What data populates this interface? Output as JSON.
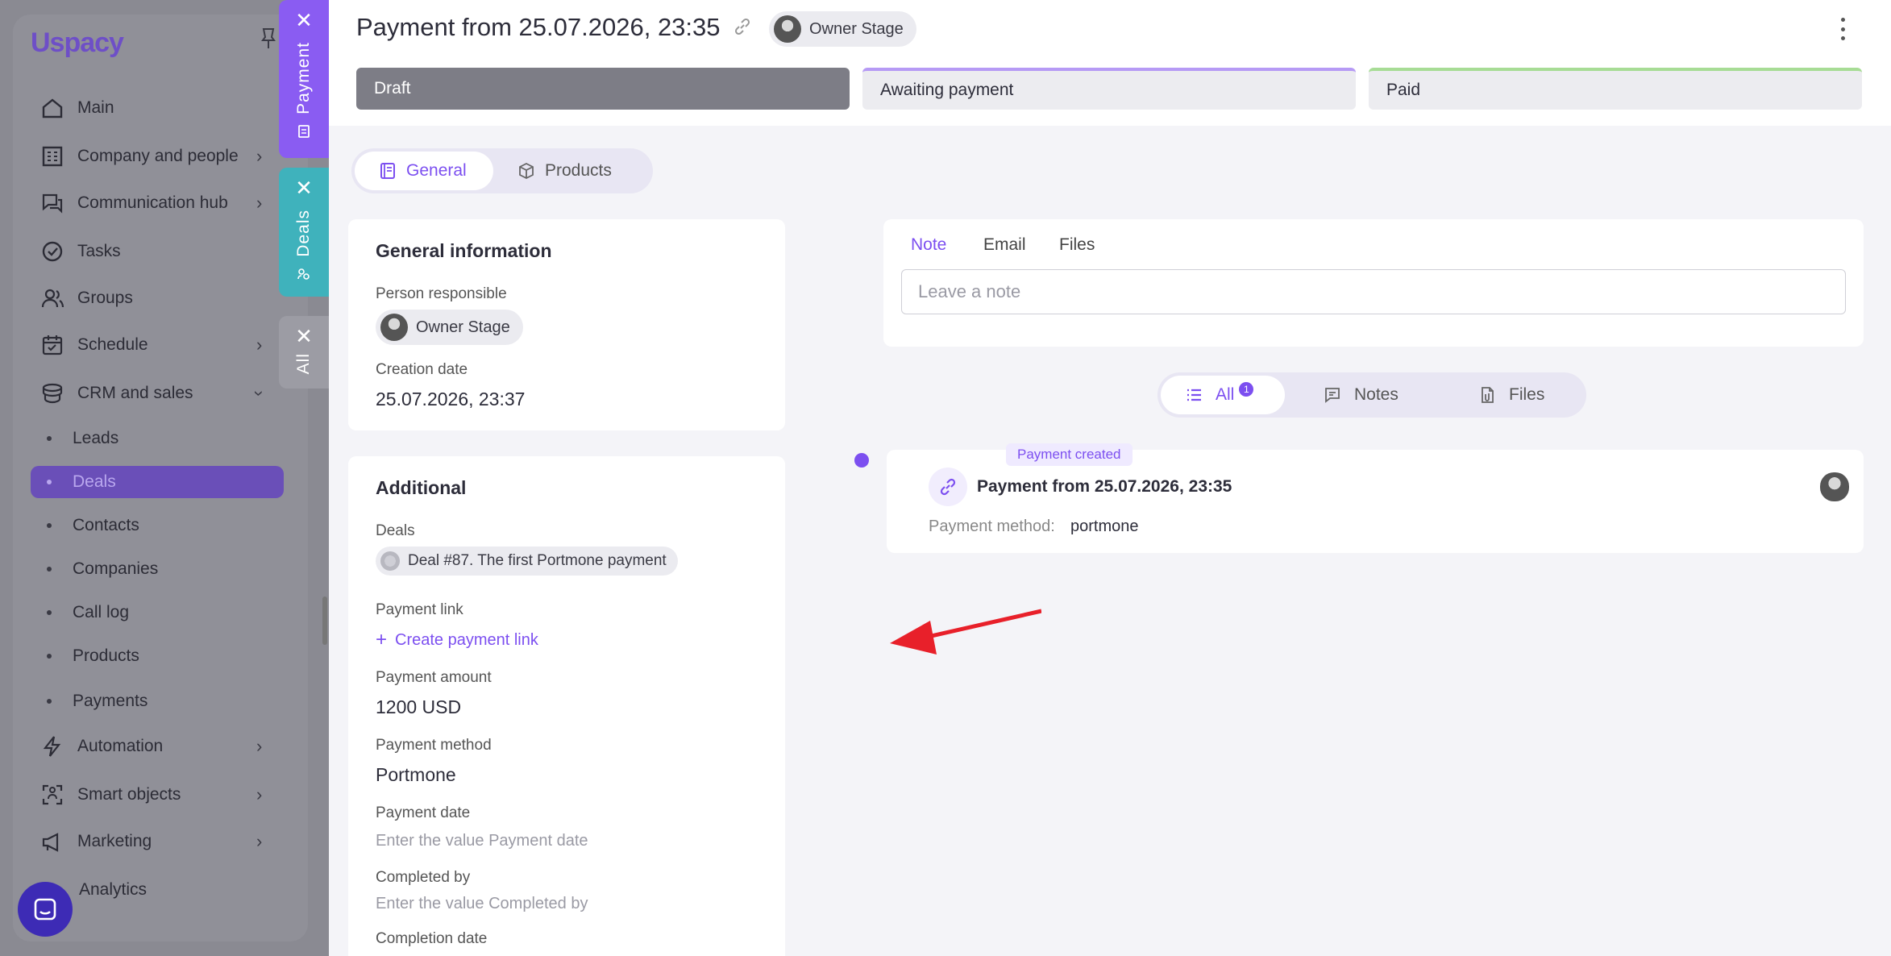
{
  "sidebar": {
    "logo": "Uspacy",
    "items": [
      {
        "label": "Main"
      },
      {
        "label": "Company and people"
      },
      {
        "label": "Communication hub"
      },
      {
        "label": "Tasks"
      },
      {
        "label": "Groups"
      },
      {
        "label": "Schedule"
      },
      {
        "label": "CRM and sales"
      },
      {
        "label": "Automation"
      },
      {
        "label": "Smart objects"
      },
      {
        "label": "Marketing"
      },
      {
        "label": "Analytics"
      }
    ],
    "crm_sub": [
      {
        "label": "Leads"
      },
      {
        "label": "Deals"
      },
      {
        "label": "Contacts"
      },
      {
        "label": "Companies"
      },
      {
        "label": "Call log"
      },
      {
        "label": "Products"
      },
      {
        "label": "Payments"
      }
    ]
  },
  "vtabs": {
    "payment": "Payment",
    "deals": "Deals",
    "all": "All"
  },
  "header": {
    "title": "Payment from 25.07.2026, 23:35",
    "owner": "Owner Stage",
    "stages": {
      "draft": "Draft",
      "awaiting": "Awaiting payment",
      "paid": "Paid"
    }
  },
  "tabs": {
    "general": "General",
    "products": "Products"
  },
  "general": {
    "title": "General information",
    "person_label": "Person responsible",
    "person_value": "Owner Stage",
    "creation_label": "Creation date",
    "creation_value": "25.07.2026, 23:37"
  },
  "additional": {
    "title": "Additional",
    "deals_label": "Deals",
    "deal_value": "Deal #87. The first Portmone payment",
    "link_label": "Payment link",
    "create_link": "Create payment link",
    "amount_label": "Payment amount",
    "amount_value": "1200 USD",
    "method_label": "Payment method",
    "method_value": "Portmone",
    "date_label": "Payment date",
    "date_placeholder": "Enter the value Payment date",
    "completed_label": "Completed by",
    "completed_placeholder": "Enter the value Completed by",
    "completion_label": "Completion date"
  },
  "note": {
    "tabs": {
      "note": "Note",
      "email": "Email",
      "files": "Files"
    },
    "placeholder": "Leave a note"
  },
  "filters": {
    "all": "All",
    "all_count": "1",
    "notes": "Notes",
    "files": "Files"
  },
  "event": {
    "tag": "Payment created",
    "title": "Payment from 25.07.2026, 23:35",
    "method_label": "Payment method:",
    "method_value": "portmone"
  },
  "colors": {
    "accent": "#7c4ff0",
    "deals_tab": "#3fb2bc",
    "payment_tab": "#8a5cf2",
    "arrow": "#e8202a"
  }
}
